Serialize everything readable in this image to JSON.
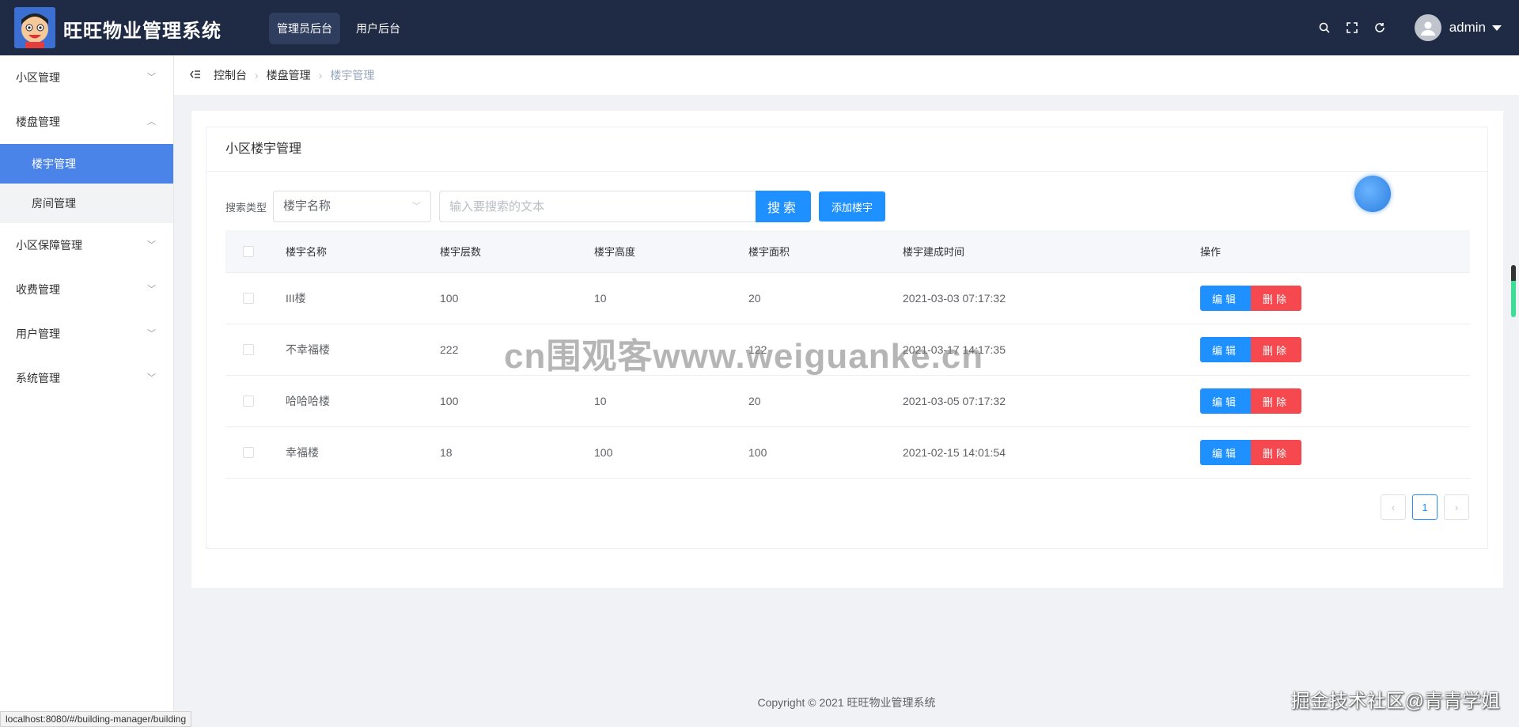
{
  "app": {
    "title": "旺旺物业管理系统"
  },
  "topnav": [
    {
      "label": "管理员后台",
      "active": true
    },
    {
      "label": "用户后台",
      "active": false
    }
  ],
  "user": {
    "name": "admin"
  },
  "sidebar": {
    "items": [
      {
        "label": "小区管理",
        "arrow": "﹀"
      },
      {
        "label": "楼盘管理",
        "arrow": "︿"
      },
      {
        "label": "小区保障管理",
        "arrow": "﹀"
      },
      {
        "label": "收费管理",
        "arrow": "﹀"
      },
      {
        "label": "用户管理",
        "arrow": "﹀"
      },
      {
        "label": "系统管理",
        "arrow": "﹀"
      }
    ],
    "sub": [
      {
        "label": "楼宇管理",
        "active": true
      },
      {
        "label": "房间管理",
        "active": false
      }
    ]
  },
  "breadcrumb": [
    "控制台",
    "楼盘管理",
    "楼宇管理"
  ],
  "panel": {
    "title": "小区楼宇管理"
  },
  "search": {
    "label": "搜索类型",
    "select_value": "楼宇名称",
    "placeholder": "输入要搜索的文本",
    "button": "搜索",
    "add_button": "添加楼宇"
  },
  "table": {
    "headers": [
      "楼宇名称",
      "楼宇层数",
      "楼宇高度",
      "楼宇面积",
      "楼宇建成时间",
      "操作"
    ],
    "rows": [
      {
        "name": "III楼",
        "floors": "100",
        "height": "10",
        "area": "20",
        "time": "2021-03-03 07:17:32"
      },
      {
        "name": "不幸福楼",
        "floors": "222",
        "height": "",
        "area": "122",
        "time": "2021-03-17 14:17:35"
      },
      {
        "name": "哈哈哈楼",
        "floors": "100",
        "height": "10",
        "area": "20",
        "time": "2021-03-05 07:17:32"
      },
      {
        "name": "幸福楼",
        "floors": "18",
        "height": "100",
        "area": "100",
        "time": "2021-02-15 14:01:54"
      }
    ],
    "edit_label": "编辑",
    "delete_label": "删除"
  },
  "pager": {
    "prev": "‹",
    "current": "1",
    "next": "›"
  },
  "footer": "Copyright © 2021 旺旺物业管理系统",
  "status_url": "localhost:8080/#/building-manager/building",
  "watermarks": {
    "site": "cn围观客www.weiguanke.cn",
    "community": "掘金技术社区@青青学姐"
  },
  "colors": {
    "topbar": "#1f2a44",
    "primary": "#1e90ff",
    "danger": "#f5484f",
    "sidebar_active": "#4a84e8"
  }
}
